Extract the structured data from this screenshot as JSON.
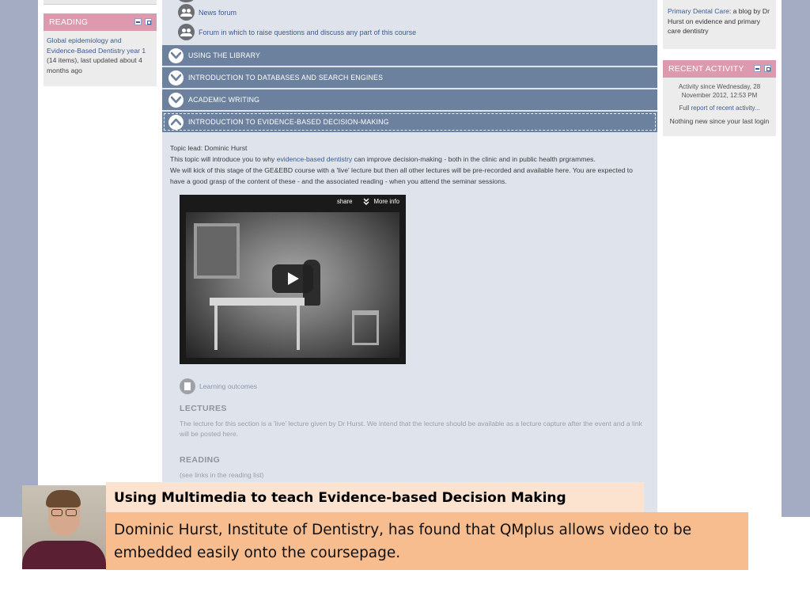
{
  "left": {
    "reading_block": {
      "title": "READING",
      "link_text": "Global epidemiology and Evidence-Based Dentistry year 1",
      "meta": "(14 items), last updated about 4 months ago"
    }
  },
  "right": {
    "blog_block": {
      "link_text": "Primary Dental Care",
      "text": ": a blog by Dr Hurst on evidence and primary care dentistry"
    },
    "recent_block": {
      "title": "RECENT ACTIVITY",
      "since": "Activity since Wednesday, 28 November 2012, 12:53 PM",
      "full_prefix": "Full ",
      "full_link": "report of recent activity...",
      "nothing": "Nothing new since your last login"
    }
  },
  "forums": [
    {
      "label": "News forum"
    },
    {
      "label": "Forum in which to raise questions and discuss any part of this course"
    }
  ],
  "sections": [
    {
      "label": "USING THE LIBRARY",
      "state": "collapsed"
    },
    {
      "label": "INTRODUCTION TO DATABASES AND SEARCH ENGINES",
      "state": "collapsed"
    },
    {
      "label": "ACADEMIC WRITING",
      "state": "collapsed"
    },
    {
      "label": "INTRODUCTION TO EVIDENCE-BASED DECISION-MAKING",
      "state": "expanded"
    }
  ],
  "topic": {
    "lead": "Topic lead: Dominic Hurst",
    "intro_pre": "This topic will introduce you to why ",
    "intro_link": "evidence-based dentistry",
    "intro_post": " can improve decision-making - both in the clinic and in public health prgrammes.",
    "plan": "We will kick of this stage of the GE&EBD course with a 'live' lecture but then all other lectures will be pre-recorded and available here. You are expected to have a good grasp of the content of these - and the associated reading - when you attend the seminar sessions."
  },
  "video": {
    "share_label": "share",
    "more_info_label": "More info"
  },
  "learning_outcomes": "Learning outcomes",
  "lectures": {
    "heading": "LECTURES",
    "text": "The lecture for this section is a 'live' lecture given by Dr Hurst. We intend that the lecture should be available as a lecture capture after the event and a link will be posted here."
  },
  "reading": {
    "heading": "READING",
    "text": "(see links in the reading list)"
  },
  "caption": {
    "title": "Using Multimedia to teach Evidence-based Decision Making",
    "body": "Dominic Hurst, Institute of Dentistry, has found that QMplus allows video to be embedded easily onto the coursepage."
  },
  "colors": {
    "section_bar": "#6c819d",
    "block_header_pink": "#dd9aae",
    "caption_title_bg": "#fce3cf",
    "caption_body_bg": "#f8bd8e"
  }
}
